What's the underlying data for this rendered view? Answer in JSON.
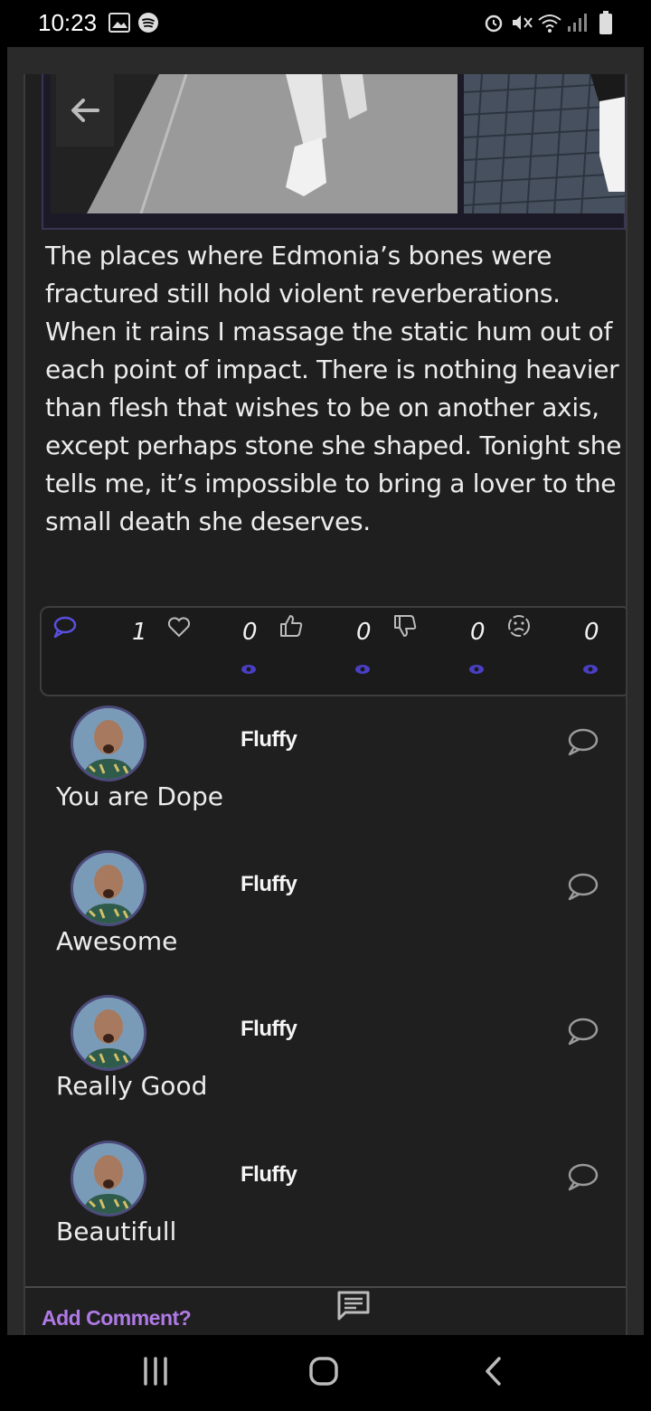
{
  "status_bar": {
    "time": "10:23"
  },
  "post": {
    "text": "The places where Edmonia’s bones were fractured still hold violent reverberations. When it rains I massage the static hum out of each point of impact. There is nothing heavier than flesh that wishes to be on another axis, except perhaps stone she shaped. Tonight she tells me, it’s impossible to bring a lover to the small death she deserves."
  },
  "stats": {
    "comments": "1",
    "likes": "0",
    "thumbs_up": "0",
    "thumbs_down": "0",
    "sad": "0",
    "views": "0"
  },
  "comments": [
    {
      "name": "Fluffy",
      "text": "You are Dope"
    },
    {
      "name": "Fluffy",
      "text": "Awesome"
    },
    {
      "name": "Fluffy",
      "text": "Really Good"
    },
    {
      "name": "Fluffy",
      "text": "Beautifull"
    }
  ],
  "footer": {
    "add_comment": "Add Comment?"
  },
  "colors": {
    "accent": "#b07ae6",
    "stat_icon": "#5b4fe0",
    "background": "#1f1f1f"
  },
  "icons": {
    "back": "arrow-left-icon",
    "comment": "speech-bubble-icon",
    "like": "heart-icon",
    "thumbs_up": "thumbs-up-icon",
    "thumbs_down": "thumbs-down-icon",
    "sad": "sad-face-icon",
    "views": "eye-icon"
  }
}
